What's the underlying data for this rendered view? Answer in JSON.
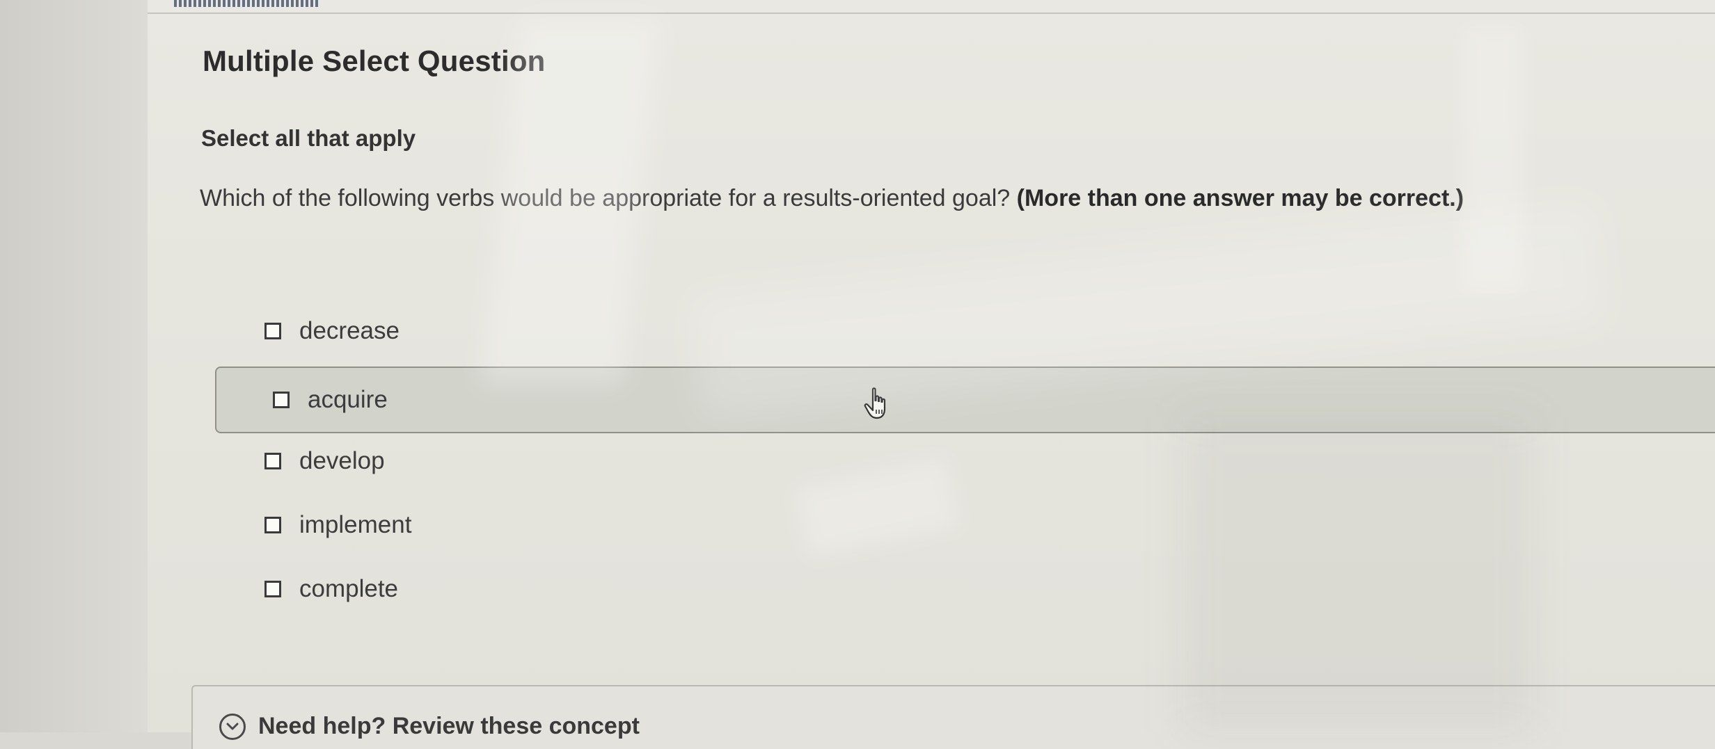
{
  "question": {
    "type_label": "Multiple Select Question",
    "instruction": "Select all that apply",
    "prompt_text": "Which of the following verbs would be appropriate for a results-oriented goal?",
    "prompt_emphasis": "(More than one answer may be correct.)"
  },
  "options": [
    {
      "label": "decrease",
      "checked": false
    },
    {
      "label": "acquire",
      "checked": false,
      "hovered": true
    },
    {
      "label": "develop",
      "checked": false
    },
    {
      "label": "implement",
      "checked": false
    },
    {
      "label": "complete",
      "checked": false
    }
  ],
  "help": {
    "label": "Need help? Review these concept"
  },
  "icons": {
    "cursor": "hand-pointer-icon",
    "help_toggle": "chevron-down-circle-icon"
  },
  "colors": {
    "text": "#3a3a3a",
    "hover_background": "#c8ccc2",
    "checkbox_border": "#3a3a3a"
  }
}
